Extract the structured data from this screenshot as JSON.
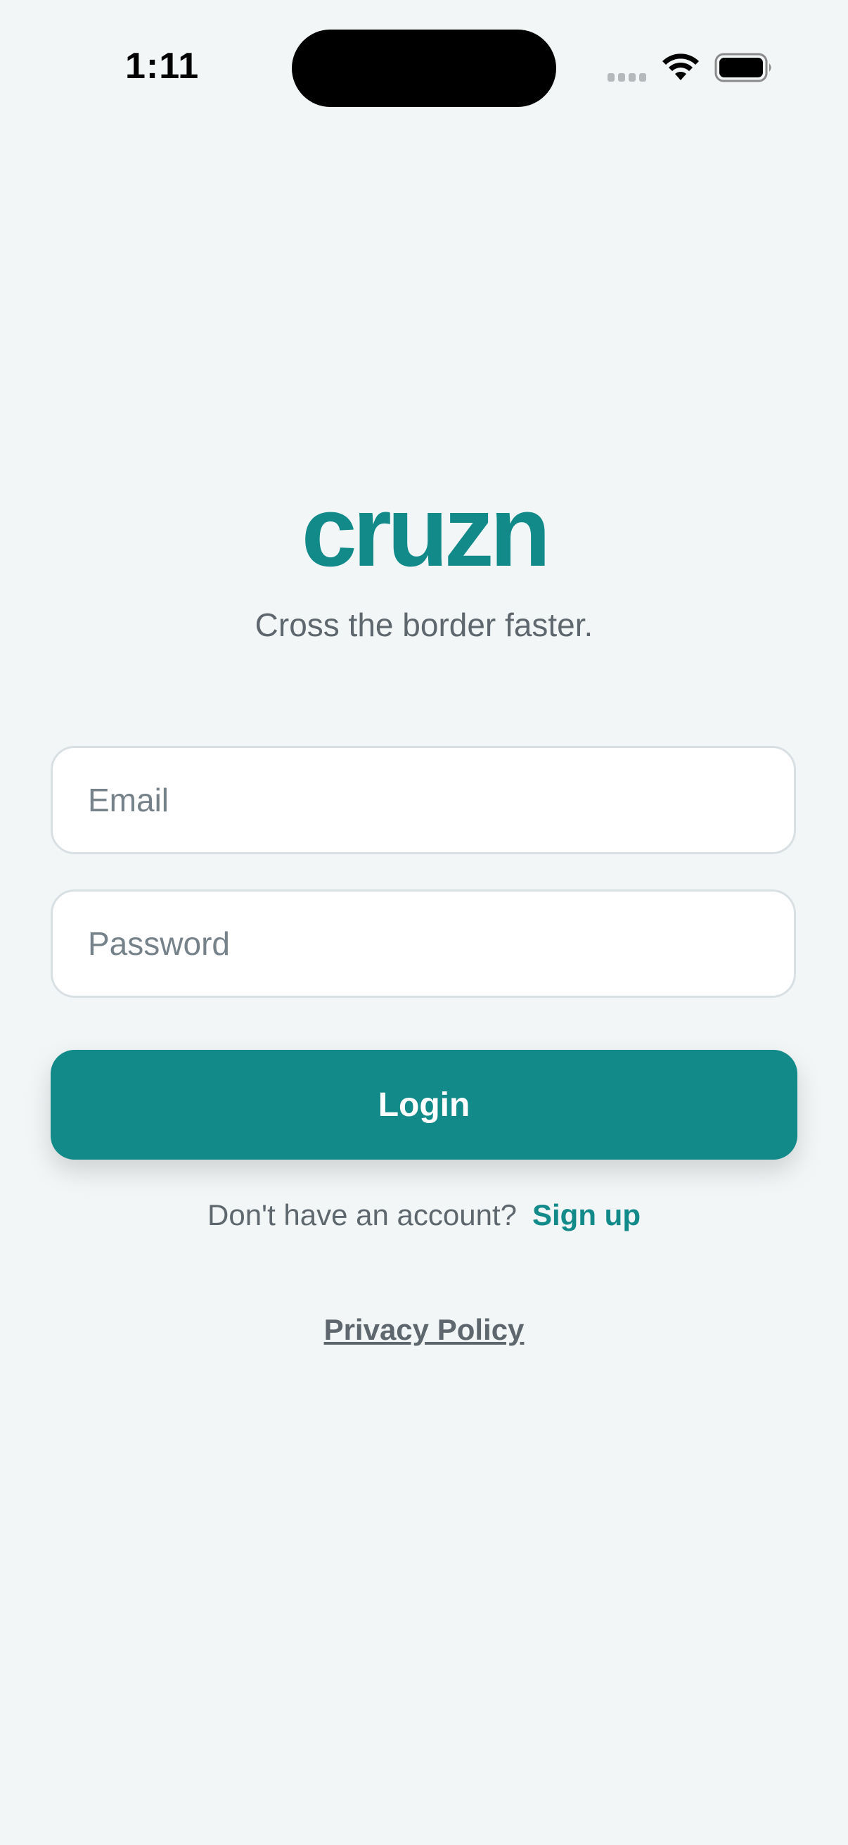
{
  "status_bar": {
    "time": "1:11",
    "signal_icon": "cellular-signal-icon",
    "wifi_icon": "wifi-icon",
    "battery_icon": "battery-icon"
  },
  "app": {
    "brand_name": "cruzn",
    "tagline": "Cross the border faster."
  },
  "form": {
    "email_placeholder": "Email",
    "email_value": "",
    "password_placeholder": "Password",
    "password_value": "",
    "login_label": "Login"
  },
  "signup": {
    "prompt": "Don't have an account?",
    "link_label": "Sign up"
  },
  "footer": {
    "privacy_label": "Privacy Policy"
  },
  "colors": {
    "accent": "#128a8a",
    "background": "#f2f6f7",
    "muted_text": "#5d676d"
  }
}
